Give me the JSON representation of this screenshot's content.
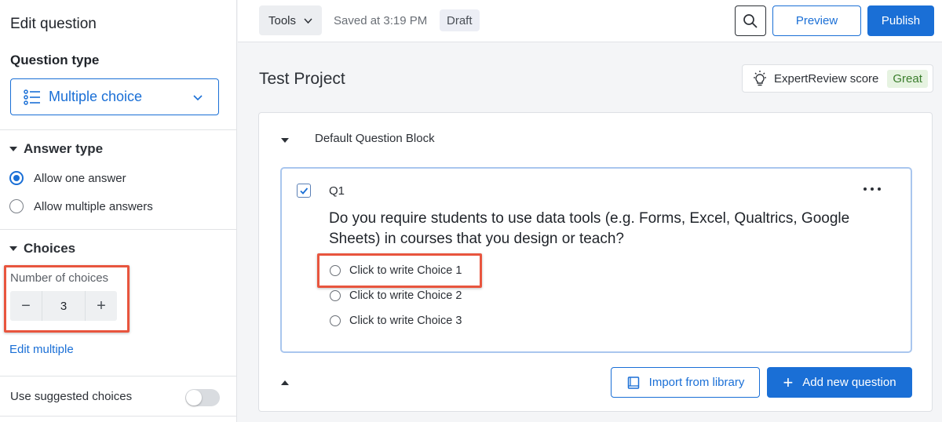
{
  "sidebar": {
    "title": "Edit question",
    "question_type_heading": "Question type",
    "question_type_value": "Multiple choice",
    "answer_type": {
      "heading": "Answer type",
      "options": [
        {
          "label": "Allow one answer",
          "selected": true
        },
        {
          "label": "Allow multiple answers",
          "selected": false
        }
      ]
    },
    "choices": {
      "heading": "Choices",
      "number_label": "Number of choices",
      "number_value": "3",
      "decrement": "−",
      "increment": "+",
      "edit_multiple": "Edit multiple"
    },
    "suggested": {
      "label": "Use suggested choices",
      "enabled": false
    }
  },
  "topbar": {
    "tools_label": "Tools",
    "saved_text": "Saved at 3:19 PM",
    "status_badge": "Draft",
    "preview_label": "Preview",
    "publish_label": "Publish"
  },
  "main": {
    "project_title": "Test Project",
    "expert_review": {
      "label": "ExpertReview score",
      "score": "Great"
    },
    "block": {
      "title": "Default Question Block",
      "question": {
        "number": "Q1",
        "text": "Do you require students to use data tools (e.g. Forms, Excel, Qualtrics, Google Sheets) in courses that you design or teach?",
        "choices": [
          "Click to write Choice 1",
          "Click to write Choice 2",
          "Click to write Choice 3"
        ]
      },
      "import_label": "Import from library",
      "add_label": "Add new question"
    }
  },
  "colors": {
    "accent": "#1a6fd6",
    "highlight": "#e8553e",
    "success": "#3a7d2c"
  }
}
